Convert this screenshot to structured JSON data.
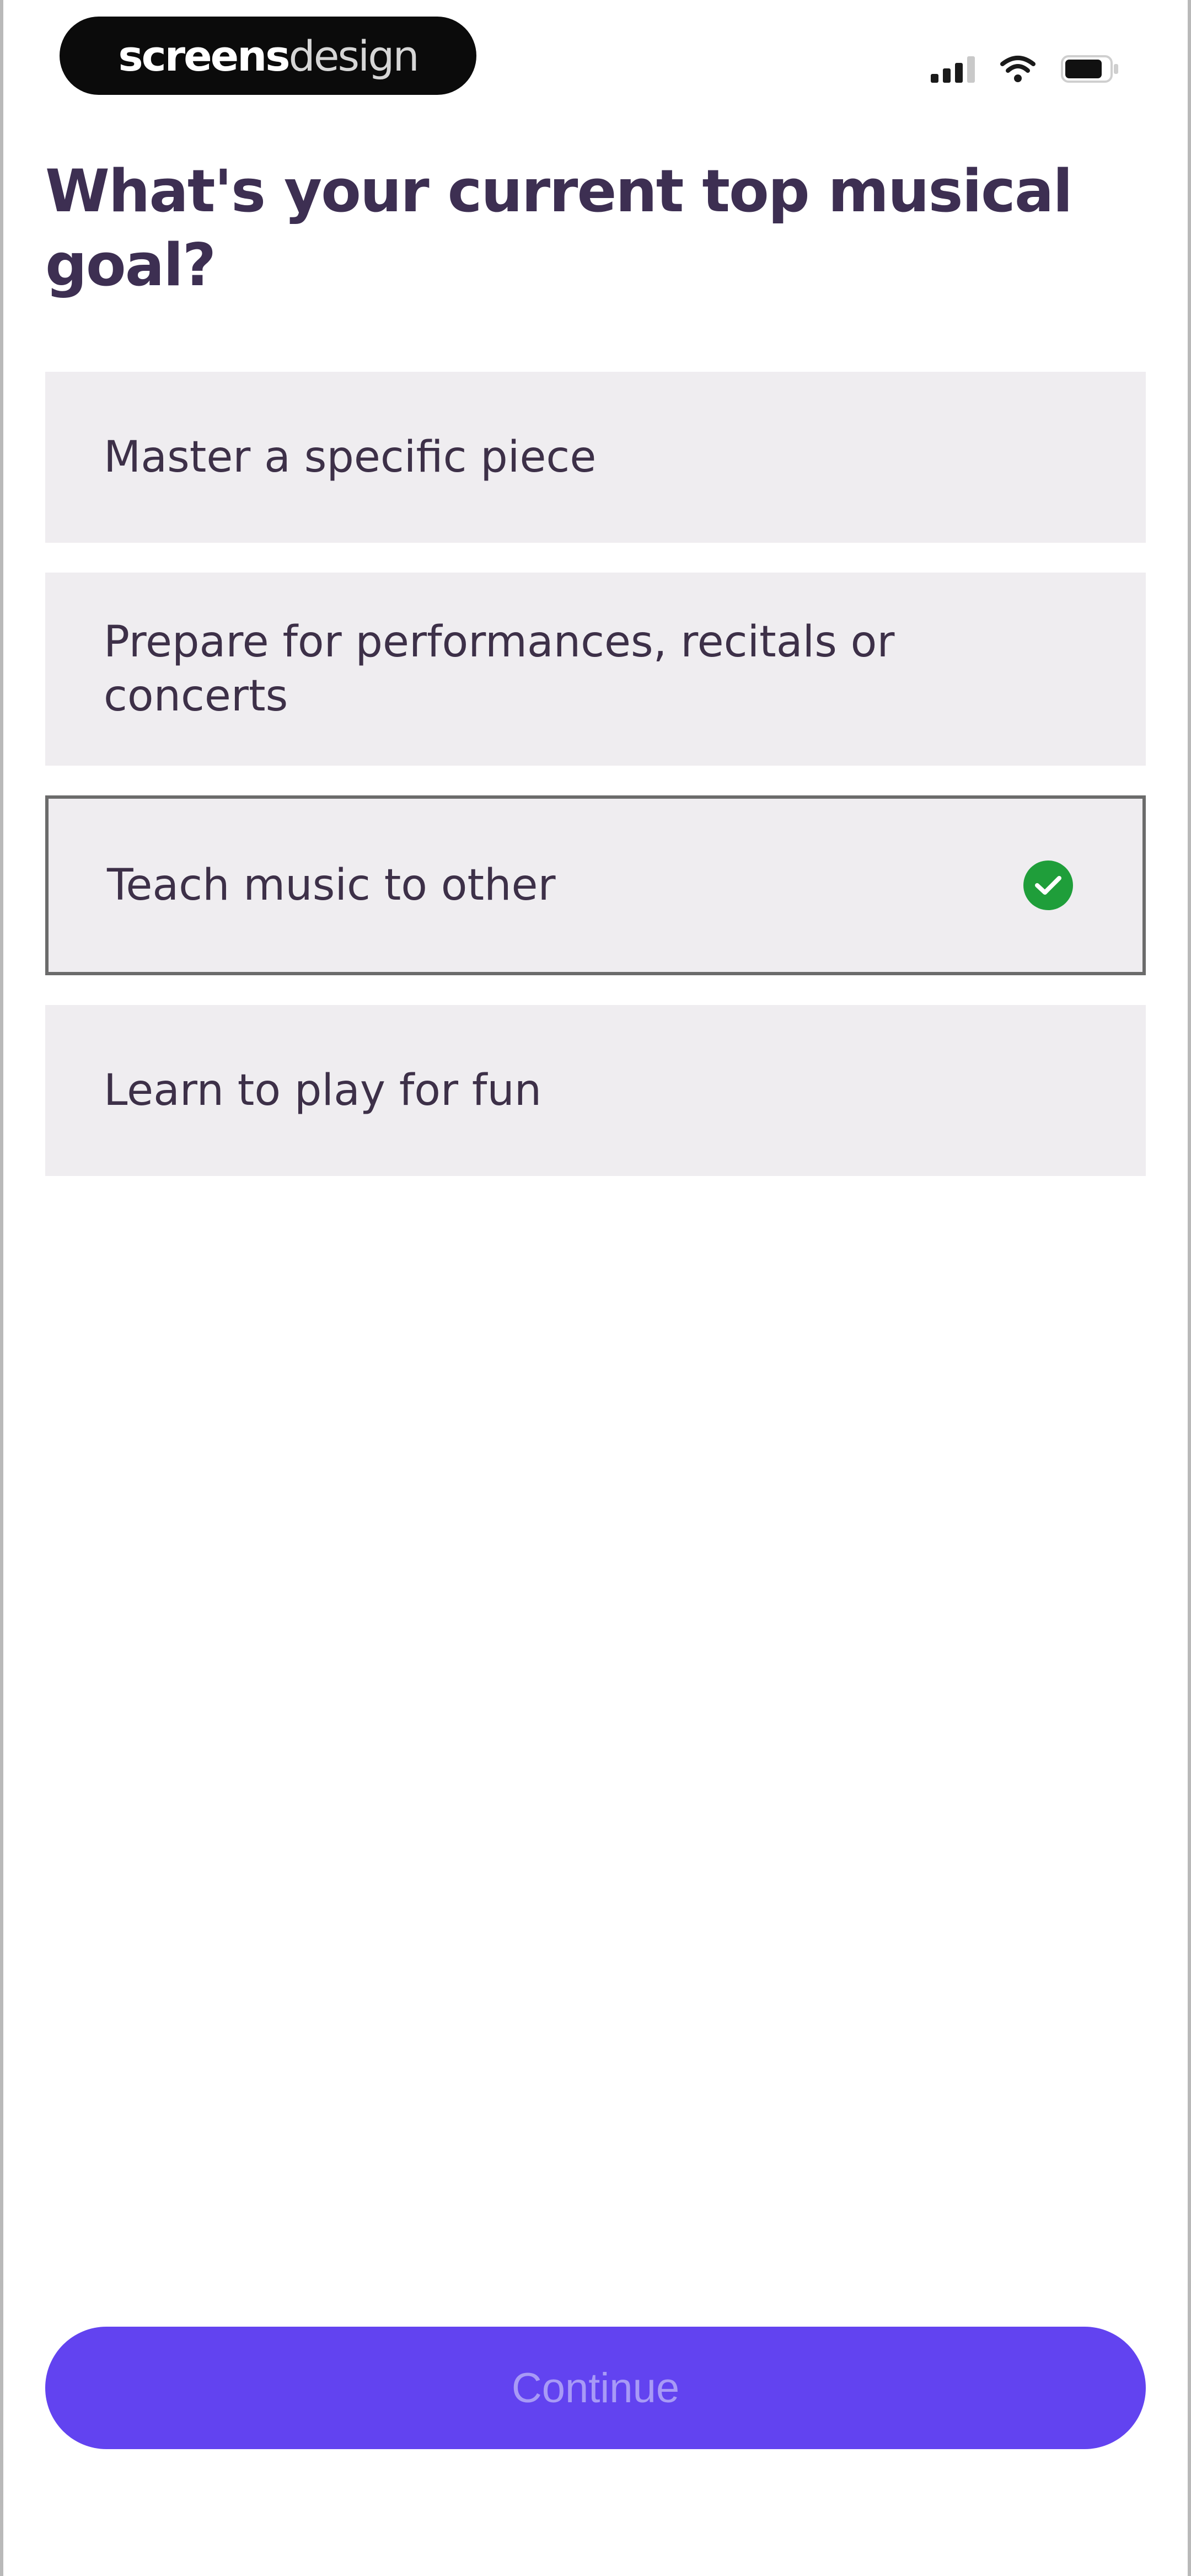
{
  "status_bar": {
    "brand_bold": "screens",
    "brand_light": "design",
    "icons": [
      "signal-icon",
      "wifi-icon",
      "battery-icon"
    ]
  },
  "question": {
    "title": "What's your current top musical goal?"
  },
  "options": [
    {
      "label": "Master a specific piece",
      "selected": false
    },
    {
      "label": "Prepare for performances, recitals or concerts",
      "selected": false
    },
    {
      "label": "Teach music to other",
      "selected": true
    },
    {
      "label": "Learn to play for fun",
      "selected": false
    }
  ],
  "footer": {
    "continue_label": "Continue"
  },
  "colors": {
    "accent": "#6243f0",
    "option_bg": "#efedf0",
    "selected_border": "#6b6b6b",
    "check": "#1f9e3a",
    "title": "#3d2f52"
  }
}
